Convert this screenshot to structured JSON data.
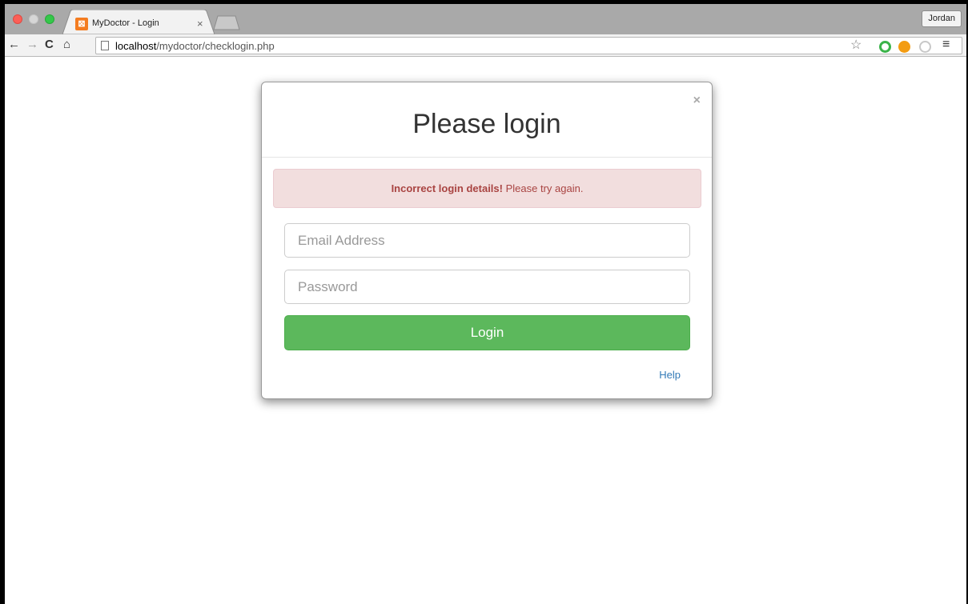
{
  "browser": {
    "tab_title": "MyDoctor - Login",
    "tab_close": "×",
    "favicon_glyph": "⊠",
    "profile_name": "Jordan",
    "url_host": "localhost",
    "url_path": "/mydoctor/checklogin.php"
  },
  "modal": {
    "title": "Please login",
    "close_glyph": "×",
    "alert_strong": "Incorrect login details!",
    "alert_text": " Please try again.",
    "email_placeholder": "Email Address",
    "password_placeholder": "Password",
    "login_label": "Login",
    "help_label": "Help"
  },
  "colors": {
    "alert_bg": "#f2dede",
    "alert_text": "#a94442",
    "button_green": "#5cb85c",
    "link_blue": "#337ab7"
  }
}
